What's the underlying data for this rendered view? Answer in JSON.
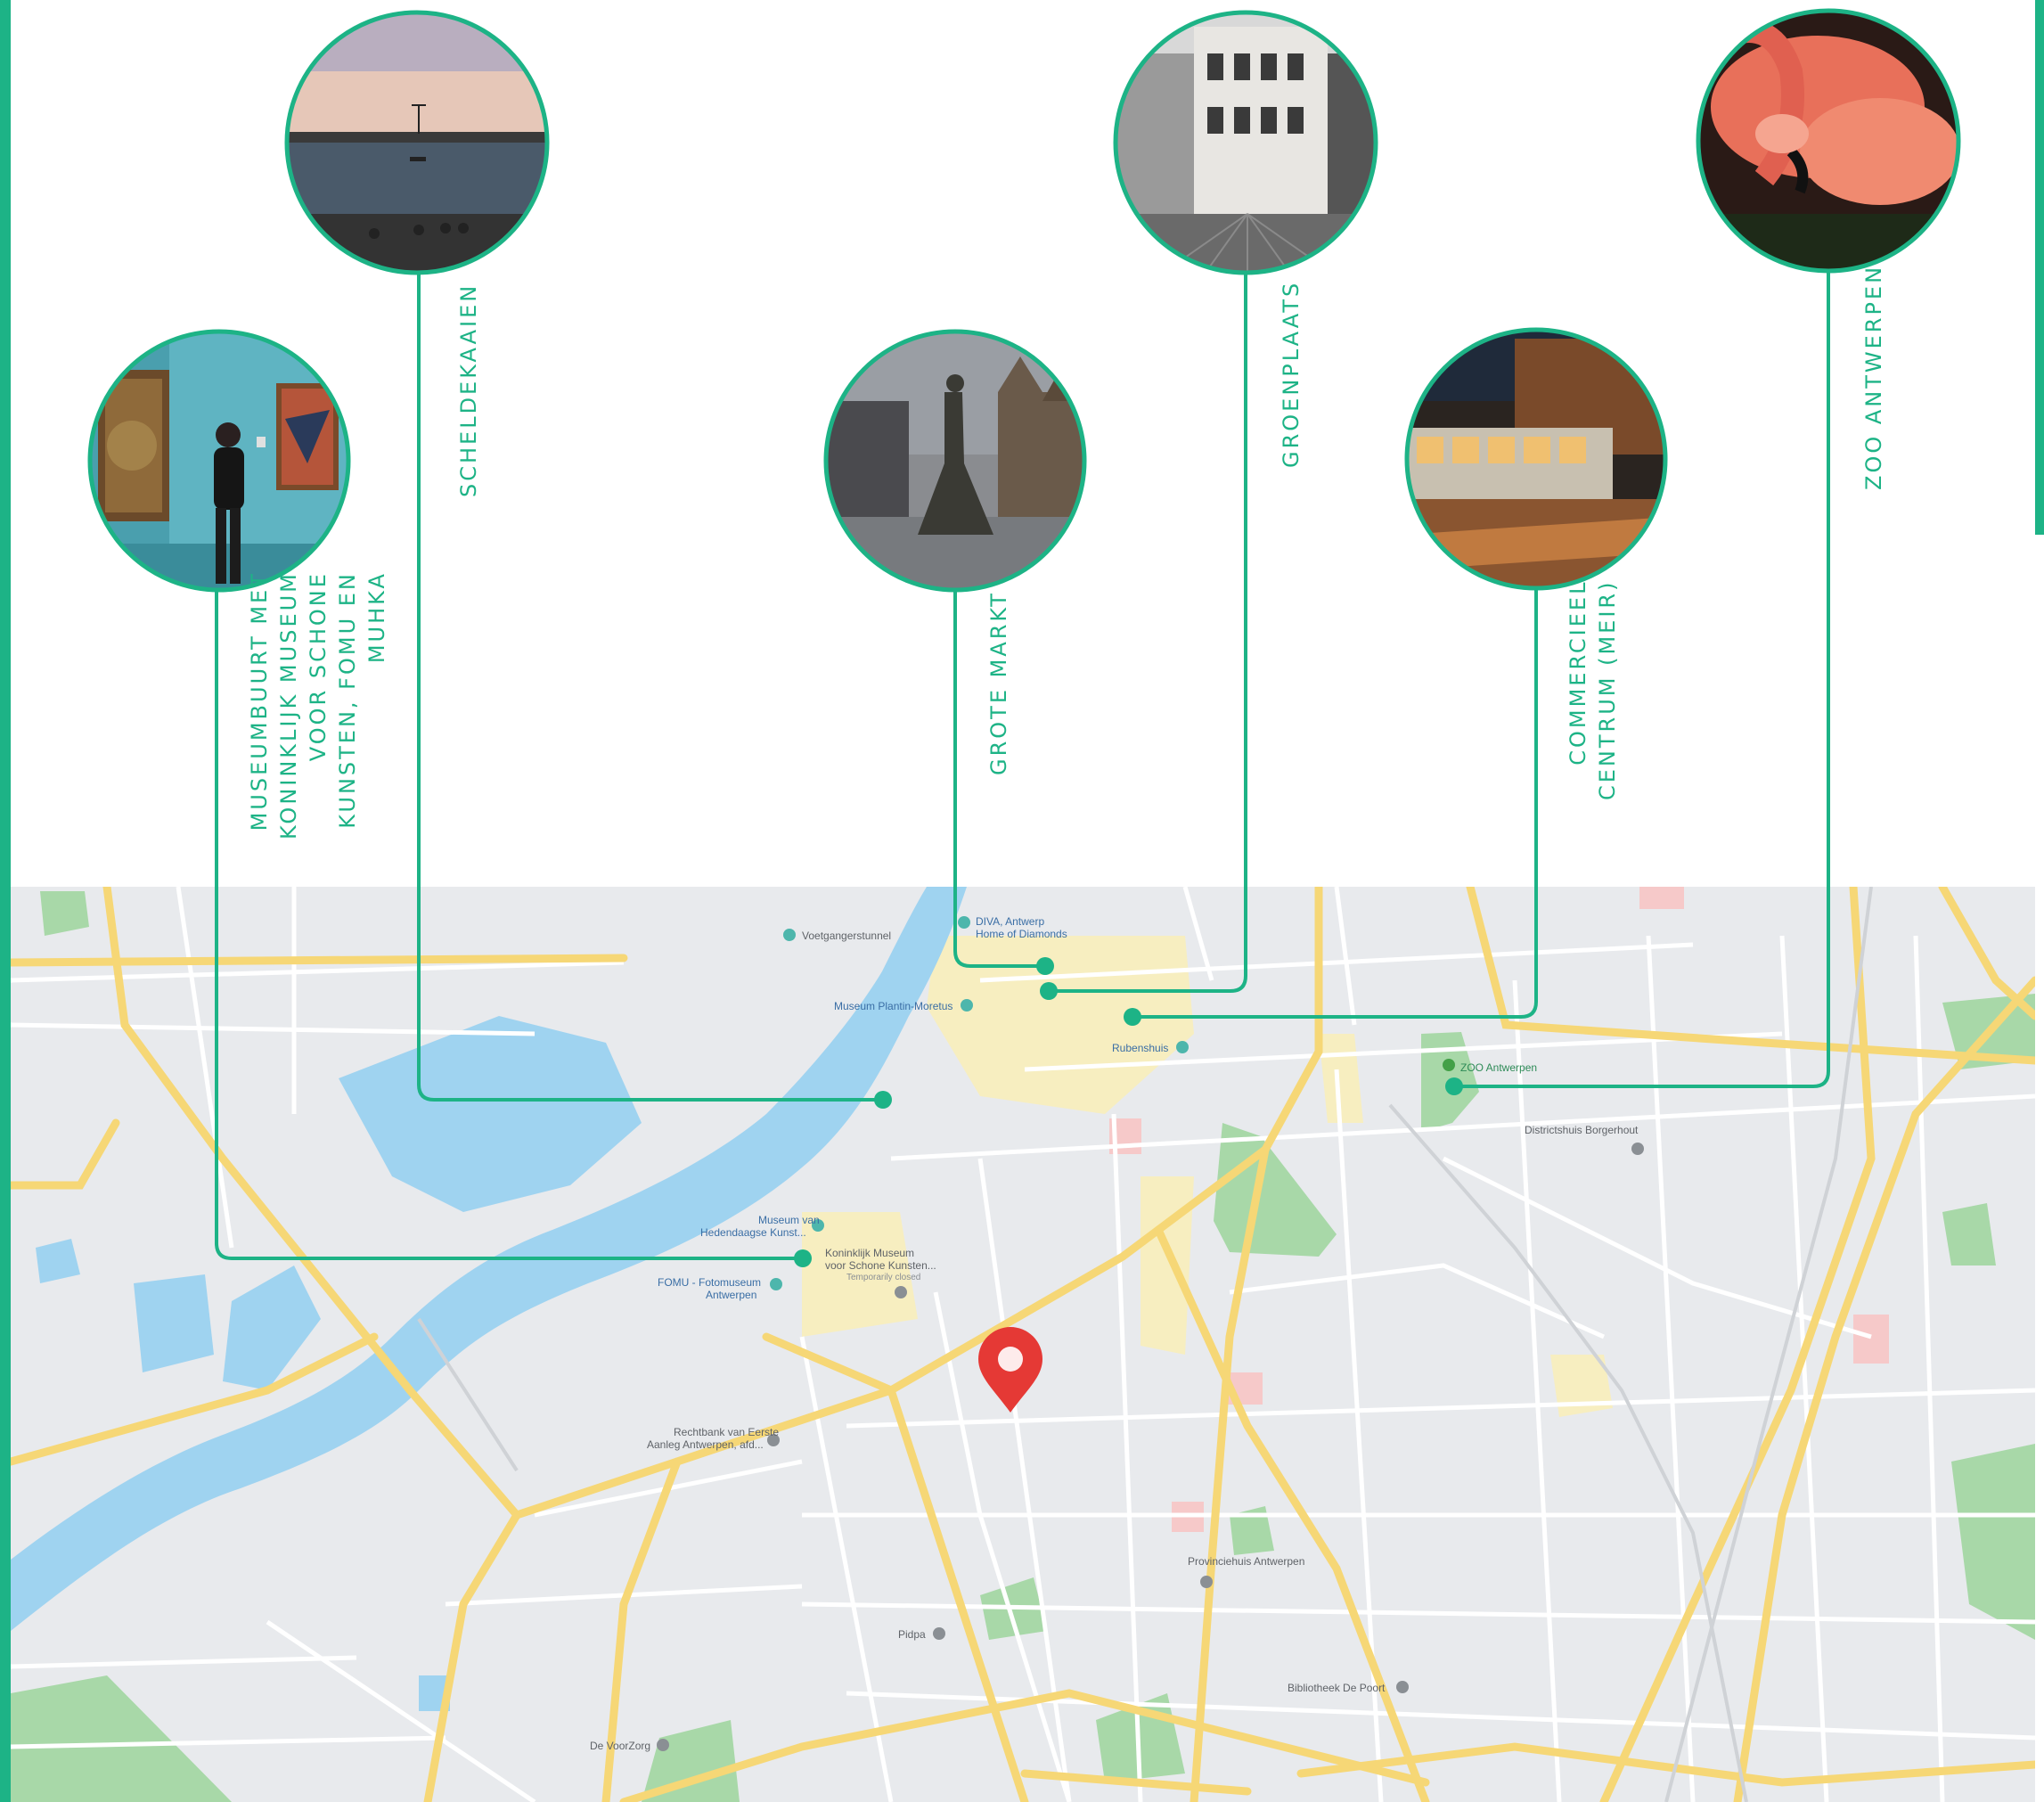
{
  "colors": {
    "accent": "#1db386",
    "water": "#9fd3f0",
    "land": "#e8eaed",
    "road_major": "#f6d776",
    "park": "#a8d8a8",
    "pin": "#e53935"
  },
  "callouts": [
    {
      "id": "museum",
      "label": "MUSEUMBUURT MET\nKONINKLIJK MUSEUM\nVOOR SCHONE\nKUNSTEN, FOMU EN\nMUHKA",
      "photo": "museum-room-photo"
    },
    {
      "id": "schelde",
      "label": "SCHELDEKAAIEN",
      "photo": "river-quay-photo"
    },
    {
      "id": "markt",
      "label": "GROTE MARKT",
      "photo": "grote-markt-fountain-photo"
    },
    {
      "id": "groen",
      "label": "GROENPLAATS",
      "photo": "groenplaats-square-photo"
    },
    {
      "id": "meir",
      "label": "COMMERCIEEL\nCENTRUM (MEIR)",
      "photo": "tram-night-photo"
    },
    {
      "id": "zoo",
      "label": "ZOO ANTWERPEN",
      "photo": "flamingo-photo"
    }
  ],
  "map": {
    "places": [
      {
        "name": "Voetgangerstunnel",
        "icon": "camera-icon"
      },
      {
        "name": "DIVA, Antwerp",
        "icon": "camera-icon"
      },
      {
        "name": "Home of Diamonds",
        "icon": ""
      },
      {
        "name": "Museum Plantin-Moretus",
        "icon": "camera-icon"
      },
      {
        "name": "Rubenshuis",
        "icon": "camera-icon"
      },
      {
        "name": "ZOO Antwerpen",
        "icon": "paw-icon"
      },
      {
        "name": "Districtshuis Borgerhout",
        "icon": "building-icon"
      },
      {
        "name": "Museum van",
        "icon": "camera-icon"
      },
      {
        "name": "Hedendaagse Kunst...",
        "icon": ""
      },
      {
        "name": "Koninklijk Museum",
        "icon": ""
      },
      {
        "name": "voor Schone Kunsten...",
        "icon": ""
      },
      {
        "name": "Temporarily closed",
        "icon": ""
      },
      {
        "name": "FOMU - Fotomuseum",
        "icon": "camera-icon"
      },
      {
        "name": "Antwerpen",
        "icon": ""
      },
      {
        "name": "Rechtbank van Eerste",
        "icon": "building-icon"
      },
      {
        "name": "Aanleg Antwerpen, afd...",
        "icon": ""
      },
      {
        "name": "Provinciehuis Antwerpen",
        "icon": "building-icon"
      },
      {
        "name": "Pidpa",
        "icon": "building-icon"
      },
      {
        "name": "Bibliotheek De Poort",
        "icon": "book-icon"
      },
      {
        "name": "De VoorZorg",
        "icon": "building-icon"
      }
    ],
    "location_pin": "map-pin-icon"
  }
}
